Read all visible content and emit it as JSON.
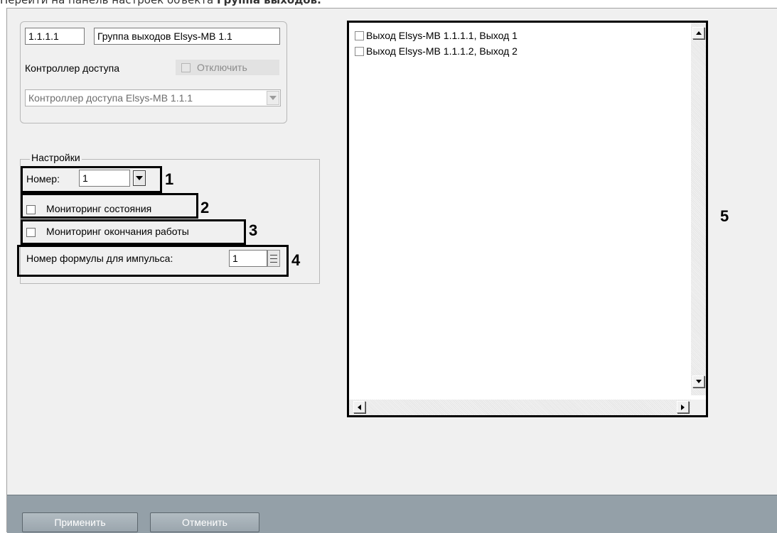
{
  "caption": {
    "prefix": "Перейти на панель настроек объекта ",
    "bold": "Группа выходов."
  },
  "object": {
    "id": "1.1.1.1",
    "name": "Группа выходов Elsys-MB 1.1",
    "parent_label": "Контроллер доступа",
    "disable_label": "Отключить",
    "parent_value": "Контроллер доступа Elsys-MB 1.1.1"
  },
  "settings": {
    "title": "Настройки",
    "number_label": "Номер:",
    "number_value": "1",
    "monitor_state_label": "Мониторинг состояния",
    "monitor_end_label": "Мониторинг окончания работы",
    "impulse_label": "Номер формулы для импульса:",
    "impulse_value": "1"
  },
  "callouts": [
    "1",
    "2",
    "3",
    "4",
    "5"
  ],
  "outputs": [
    {
      "label": "Выход Elsys-MB 1.1.1.1, Выход 1",
      "checked": false
    },
    {
      "label": "Выход Elsys-MB 1.1.1.2, Выход 2",
      "checked": false
    }
  ],
  "buttons": {
    "apply": "Применить",
    "cancel": "Отменить"
  }
}
